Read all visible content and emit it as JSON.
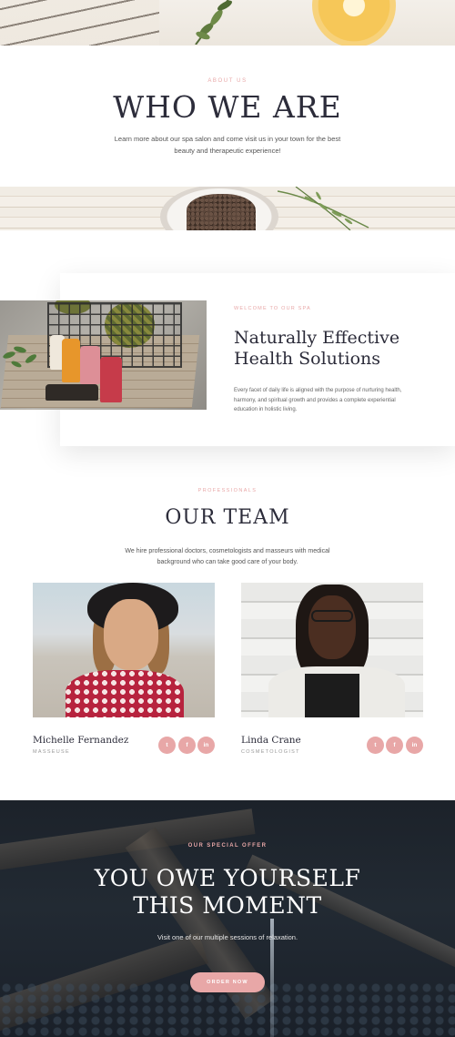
{
  "about": {
    "eyebrow": "ABOUT US",
    "title": "WHO WE ARE",
    "text": "Learn more about our spa salon and come visit us in your town for the best beauty and therapeutic experience!"
  },
  "welcome": {
    "eyebrow": "WELCOME TO OUR SPA",
    "title": "Naturally Effective Health Solutions",
    "text": "Every facet of daily life is aligned with the purpose of nurturing health, harmony, and spiritual growth and provides a complete experiential education in holistic living."
  },
  "team": {
    "eyebrow": "PROFESSIONALS",
    "title": "OUR TEAM",
    "text": "We hire professional doctors, cosmetologists and masseurs with medical background who can take good care of your body.",
    "members": [
      {
        "name": "Michelle Fernandez",
        "role": "MASSEUSE",
        "social": [
          "twitter-icon",
          "facebook-icon",
          "linkedin-icon"
        ],
        "social_glyphs": [
          "t",
          "f",
          "in"
        ]
      },
      {
        "name": "Linda Crane",
        "role": "COSMETOLOGIST",
        "social": [
          "twitter-icon",
          "facebook-icon",
          "linkedin-icon"
        ],
        "social_glyphs": [
          "t",
          "f",
          "in"
        ]
      }
    ]
  },
  "offer": {
    "eyebrow": "OUR SPECIAL OFFER",
    "title_line1": "YOU OWE YOURSELF",
    "title_line2": "THIS MOMENT",
    "text": "Visit one of our multiple sessions of relaxation.",
    "button_label": "ORDER NOW"
  },
  "colors": {
    "accent": "#e8a7a7",
    "heading": "#2c2c3a",
    "offer_background": "#1f2630"
  }
}
